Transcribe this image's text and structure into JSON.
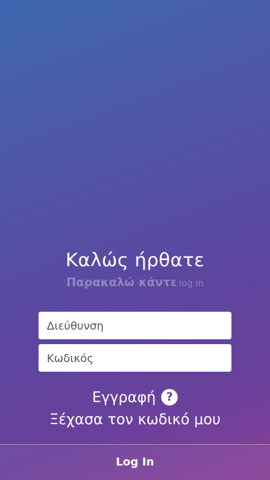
{
  "welcome": {
    "title": "Καλώς ήρθατε",
    "subtitle_main": "Παρακαλώ κάντε",
    "subtitle_small": "log in"
  },
  "form": {
    "username_placeholder": "Διεύθυνση",
    "password_placeholder": "Κωδικός"
  },
  "links": {
    "register_label": "Εγγραφή",
    "help_icon_glyph": "?",
    "forgot_password_label": "Ξέχασα τον κωδικό μου"
  },
  "login_button": {
    "label": "Log In"
  },
  "colors": {
    "gradient_top": "#3e67b0",
    "gradient_bottom": "#8a3f96",
    "text": "#ffffff",
    "subtitle": "#8f86bf"
  },
  "icons": {
    "help": "question-circle-icon"
  }
}
